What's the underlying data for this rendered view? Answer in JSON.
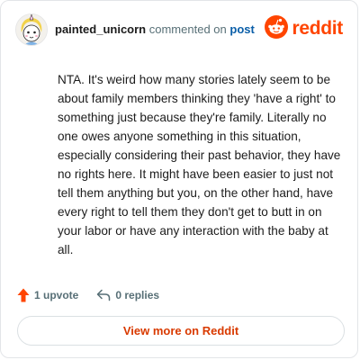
{
  "header": {
    "username": "painted_unicorn",
    "action_text": "commented on",
    "target_link": "post",
    "brand_word": "reddit"
  },
  "comment": {
    "body": "NTA. It's weird how many stories lately seem to be about family members thinking they 'have a right' to something just because they're family. Literally no one owes anyone something in this situation, especially considering their past behavior, they have no rights here. It might have been easier to just not tell them anything but you, on the other hand, have every right to tell them they don't get to butt in on your labor or have any interaction with the baby at all."
  },
  "actions": {
    "upvote_label": "1 upvote",
    "replies_label": "0 replies"
  },
  "footer": {
    "view_button_label": "View more on Reddit"
  },
  "colors": {
    "brand": "#ff4500",
    "link": "#0a5ea8",
    "muted": "#576f76",
    "button_text": "#d93a00"
  },
  "icons": {
    "avatar": "avatar-icon",
    "brand": "reddit-snoo-icon",
    "upvote": "upvote-arrow-icon",
    "reply": "reply-arrow-icon"
  }
}
